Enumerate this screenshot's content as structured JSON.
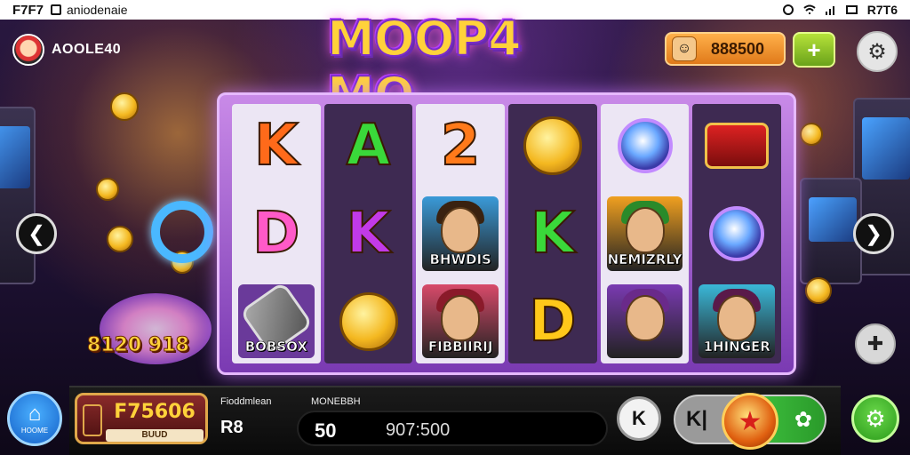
{
  "statusbar": {
    "time": "F7F7",
    "app_name": "aniodenaie",
    "right_text": "R7T6"
  },
  "player": {
    "name": "AOOLE40"
  },
  "game": {
    "title": "MOOP4 MO"
  },
  "coins": {
    "value": "888500",
    "add_label": "+"
  },
  "reels": [
    [
      {
        "type": "letter",
        "text": "K",
        "color": "#ff6a1a"
      },
      {
        "type": "letter",
        "text": "D",
        "color": "#ff5ac8"
      },
      {
        "type": "bottle",
        "label": "BOBSOX"
      }
    ],
    [
      {
        "type": "letter",
        "text": "A",
        "color": "#3ad83a"
      },
      {
        "type": "letter",
        "text": "K",
        "color": "#c23ae8"
      },
      {
        "type": "coin"
      }
    ],
    [
      {
        "type": "letter",
        "text": "2",
        "color": "#ff7a1a"
      },
      {
        "type": "portrait",
        "label": "BHWDIS",
        "bg": "#3a9ad8",
        "hair": "#3a2210"
      },
      {
        "type": "portrait",
        "label": "FIBBIIRIJ",
        "bg": "#d84a6a",
        "hair": "#8a1a2a"
      }
    ],
    [
      {
        "type": "coin"
      },
      {
        "type": "letter",
        "text": "K",
        "color": "#3ad83a"
      },
      {
        "type": "letter",
        "text": "D",
        "color": "#ffc81a"
      }
    ],
    [
      {
        "type": "gem"
      },
      {
        "type": "portrait",
        "label": "NEMIZRLY",
        "bg": "#f0a020",
        "hair": "#2a8a2a"
      },
      {
        "type": "portrait",
        "label": "",
        "bg": "#7a3ab2",
        "hair": "#6a2a8a"
      }
    ],
    [
      {
        "type": "chest"
      },
      {
        "type": "gem"
      },
      {
        "type": "portrait",
        "label": "1HINGER",
        "bg": "#3ab8d8",
        "hair": "#5a1a4a"
      }
    ]
  ],
  "jackpot_text": "8120 918",
  "home": {
    "label": "HOOME"
  },
  "balance": {
    "amount": "F75606",
    "sub": "BUUD"
  },
  "stats": {
    "left_label": "Fioddmlean",
    "left_value": "R8",
    "right_label": "MONEBBH"
  },
  "bet": {
    "value": "50",
    "win": "907:500"
  },
  "controls": {
    "prev_label": "K|",
    "cursor_label": "K"
  },
  "colors": {
    "accent_gold": "#ffd23a",
    "frame_purple": "#c98ae8",
    "spin_green": "#3ec03e"
  },
  "icons": [
    "avatar",
    "chip-icon",
    "plus-icon",
    "gear-icon",
    "chevron-left-icon",
    "chevron-right-icon",
    "puzzle-icon",
    "home-icon",
    "cursor-icon",
    "star-spin-icon",
    "autoplay-icon"
  ]
}
